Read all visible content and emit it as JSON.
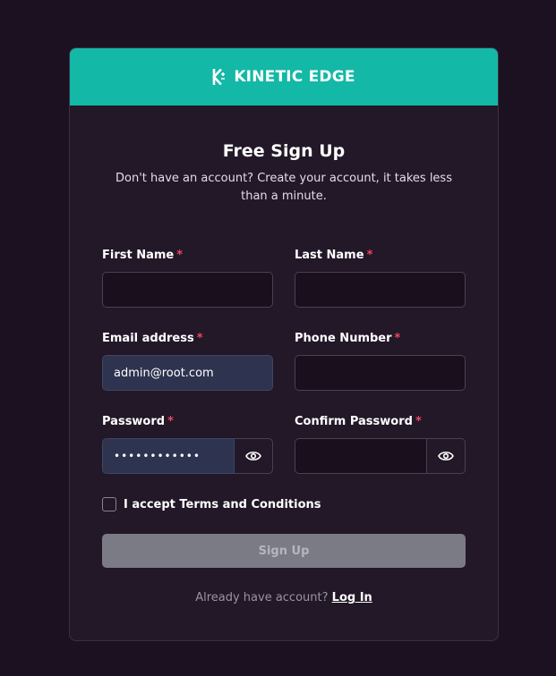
{
  "brand": {
    "name": "KINETIC EDGE",
    "accent_color": "#14b8a6"
  },
  "form": {
    "title": "Free Sign Up",
    "subtitle": "Don't have an account? Create your account, it takes less than a minute.",
    "required_marker": "*",
    "first_name": {
      "label": "First Name",
      "value": ""
    },
    "last_name": {
      "label": "Last Name",
      "value": ""
    },
    "email": {
      "label": "Email address",
      "value": "admin@root.com"
    },
    "phone": {
      "label": "Phone Number",
      "value": ""
    },
    "password": {
      "label": "Password",
      "value_masked": "••••••••••••",
      "toggle_icon": "eye-icon"
    },
    "confirm_password": {
      "label": "Confirm Password",
      "value_masked": "",
      "toggle_icon": "eye-icon"
    },
    "terms": {
      "label": "I accept Terms and Conditions",
      "checked": false
    },
    "submit_label": "Sign Up"
  },
  "footer": {
    "prompt": "Already have account?",
    "link_label": "Log In"
  }
}
